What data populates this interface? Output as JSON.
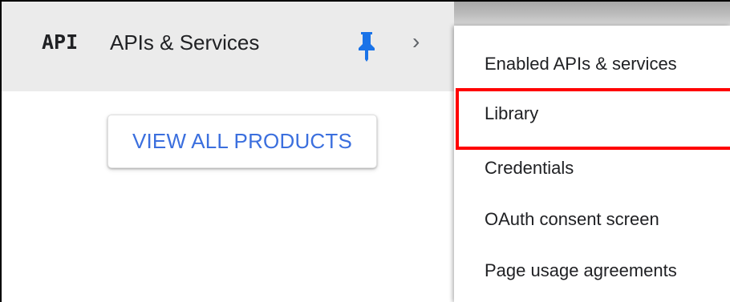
{
  "header": {
    "logo_text": "API",
    "title": "APIs & Services",
    "pin_icon": "pin-icon",
    "pin_color": "#1a73e8",
    "chevron": "›"
  },
  "main": {
    "view_all_label": "VIEW ALL PRODUCTS",
    "view_all_color": "#3b6fde"
  },
  "submenu": {
    "items": [
      {
        "label": "Enabled APIs & services"
      },
      {
        "label": "Library",
        "highlighted": true
      },
      {
        "label": "Credentials"
      },
      {
        "label": "OAuth consent screen"
      },
      {
        "label": "Page usage agreements"
      }
    ],
    "highlight_color": "#ff0000"
  }
}
